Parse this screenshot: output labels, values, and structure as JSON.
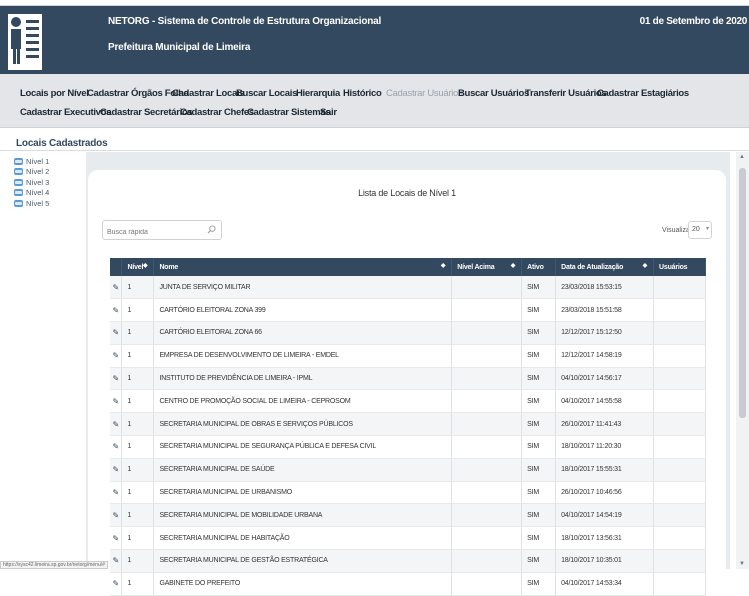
{
  "header": {
    "title": "NETORG - Sistema de Controle de Estrutura Organizacional",
    "subtitle": "Prefeitura Municipal de Limeira",
    "date": "01 de Setembro de 2020"
  },
  "menu": {
    "row1": [
      {
        "label": "Locais por Nível",
        "disabled": false
      },
      {
        "label": "Cadastrar Órgãos Folha",
        "disabled": false
      },
      {
        "label": "Cadastrar Locais",
        "disabled": false
      },
      {
        "label": "Buscar Locais",
        "disabled": false
      },
      {
        "label": "Hierarquia",
        "disabled": false
      },
      {
        "label": "Histórico",
        "disabled": false
      },
      {
        "label": "Cadastrar Usuários",
        "disabled": true
      },
      {
        "label": "Buscar Usuários",
        "disabled": false
      },
      {
        "label": "Transferir Usuários",
        "disabled": false
      },
      {
        "label": "Cadastrar Estagiários",
        "disabled": false
      }
    ],
    "row2": [
      {
        "label": "Cadastrar Executivos",
        "disabled": false
      },
      {
        "label": "Cadastrar Secretários",
        "disabled": false
      },
      {
        "label": "Cadastrar Chefes",
        "disabled": false
      },
      {
        "label": "Cadastrar Sistemas",
        "disabled": false
      },
      {
        "label": "Sair",
        "disabled": false
      }
    ]
  },
  "section_title": "Locais Cadastrados",
  "tree": [
    "Nível 1",
    "Nível 2",
    "Nível 3",
    "Nível 4",
    "Nível 5"
  ],
  "panel": {
    "title": "Lista de Locais de Nível 1",
    "search_placeholder": "Busca rápida",
    "view_label": "Visualizar",
    "view_value": "20"
  },
  "table": {
    "headers": [
      "Nível",
      "Nome",
      "Nível Acima",
      "Ativo",
      "Data de Atualização",
      "Usuários"
    ],
    "rows": [
      [
        "1",
        "JUNTA DE SERVIÇO MILITAR",
        "",
        "SIM",
        "23/03/2018 15:53:15",
        ""
      ],
      [
        "1",
        "CARTÓRIO ELEITORAL ZONA 399",
        "",
        "SIM",
        "23/03/2018 15:51:58",
        ""
      ],
      [
        "1",
        "CARTÓRIO ELEITORAL ZONA 66",
        "",
        "SIM",
        "12/12/2017 15:12:50",
        ""
      ],
      [
        "1",
        "EMPRESA DE DESENVOLVIMENTO DE LIMEIRA - EMDEL",
        "",
        "SIM",
        "12/12/2017 14:58:19",
        ""
      ],
      [
        "1",
        "INSTITUTO DE PREVIDÊNCIA DE LIMEIRA - IPML",
        "",
        "SIM",
        "04/10/2017 14:56:17",
        ""
      ],
      [
        "1",
        "CENTRO DE PROMOÇÃO SOCIAL DE LIMEIRA - CEPROSOM",
        "",
        "SIM",
        "04/10/2017 14:55:58",
        ""
      ],
      [
        "1",
        "SECRETARIA MUNICIPAL DE OBRAS E SERVIÇOS PÚBLICOS",
        "",
        "SIM",
        "26/10/2017 11:41:43",
        ""
      ],
      [
        "1",
        "SECRETARIA MUNICIPAL DE SEGURANÇA PÚBLICA E DEFESA CIVIL",
        "",
        "SIM",
        "18/10/2017 11:20:30",
        ""
      ],
      [
        "1",
        "SECRETARIA MUNICIPAL DE SAÚDE",
        "",
        "SIM",
        "18/10/2017 15:55:31",
        ""
      ],
      [
        "1",
        "SECRETARIA MUNICIPAL DE URBANISMO",
        "",
        "SIM",
        "26/10/2017 10:46:56",
        ""
      ],
      [
        "1",
        "SECRETARIA MUNICIPAL DE MOBILIDADE URBANA",
        "",
        "SIM",
        "04/10/2017 14:54:19",
        ""
      ],
      [
        "1",
        "SECRETARIA MUNICIPAL DE HABITAÇÃO",
        "",
        "SIM",
        "18/10/2017 13:56:31",
        ""
      ],
      [
        "1",
        "SECRETARIA MUNICIPAL DE GESTÃO ESTRATÉGICA",
        "",
        "SIM",
        "18/10/2017 10:35:01",
        ""
      ],
      [
        "1",
        "GABINETE DO PREFEITO",
        "",
        "SIM",
        "04/10/2017 14:53:34",
        ""
      ]
    ]
  },
  "status_url": "https://sysc42.limeira.sp.gov.br/netorg/menu/#"
}
